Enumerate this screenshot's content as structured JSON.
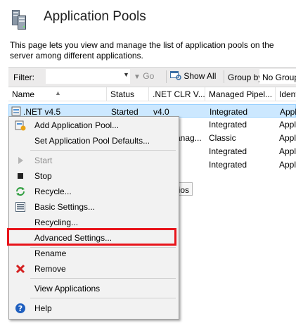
{
  "header": {
    "title": "Application Pools",
    "description": "This page lets you view and manage the list of application pools on the server among different applications."
  },
  "toolbar": {
    "filter_label": "Filter:",
    "filter_value": "",
    "go_label": "Go",
    "show_all_label": "Show All",
    "group_by_label": "Group by:",
    "group_by_value": "No Group"
  },
  "table": {
    "columns": [
      "Name",
      "Status",
      ".NET CLR V...",
      "Managed Pipel...",
      "Identity"
    ],
    "rows": [
      {
        "name": ".NET v4.5",
        "status": "Started",
        "clr": "v4.0",
        "pipeline": "Integrated",
        "identity": "Appl"
      },
      {
        "name": "",
        "status": "",
        "clr": "",
        "pipeline": "Integrated",
        "identity": "Appl"
      },
      {
        "name": "",
        "status": "",
        "clr": "anag...",
        "pipeline": "Classic",
        "identity": "Appl"
      },
      {
        "name": "",
        "status": "",
        "clr": "",
        "pipeline": "Integrated",
        "identity": "Appl"
      },
      {
        "name": "",
        "status": "",
        "clr": "",
        "pipeline": "Integrated",
        "identity": "Appl"
      }
    ]
  },
  "tooltip": "ários",
  "context_menu": {
    "items": [
      {
        "label": "Add Application Pool...",
        "icon": "add-pool-icon",
        "enabled": true
      },
      {
        "label": "Set Application Pool Defaults...",
        "icon": "",
        "enabled": true
      },
      {
        "label": "Start",
        "icon": "play-icon",
        "enabled": false
      },
      {
        "label": "Stop",
        "icon": "stop-icon",
        "enabled": true
      },
      {
        "label": "Recycle...",
        "icon": "recycle-icon",
        "enabled": true
      },
      {
        "label": "Basic Settings...",
        "icon": "settings-icon",
        "enabled": true
      },
      {
        "label": "Recycling...",
        "icon": "",
        "enabled": true
      },
      {
        "label": "Advanced Settings...",
        "icon": "",
        "enabled": true
      },
      {
        "label": "Rename",
        "icon": "",
        "enabled": true
      },
      {
        "label": "Remove",
        "icon": "remove-icon",
        "enabled": true
      },
      {
        "label": "View Applications",
        "icon": "",
        "enabled": true
      },
      {
        "label": "Help",
        "icon": "help-icon",
        "enabled": true
      }
    ]
  },
  "colors": {
    "selection": "#cce8ff",
    "highlight_box": "#e8141b",
    "toolbar_bg": "#ecebeb",
    "menu_bg": "#f2f2f2"
  }
}
